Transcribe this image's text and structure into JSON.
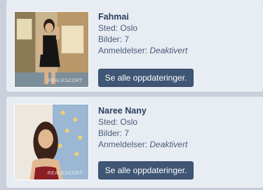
{
  "listings": [
    {
      "name": "Fahmai",
      "location_label": "Sted: ",
      "location": "Oslo",
      "photos_label": "Bilder: ",
      "photos": "7",
      "reviews_label": "Anmeldelser: ",
      "reviews": "Deaktivert",
      "button": "Se alle oppdateringer.",
      "watermark": "REALESCORT"
    },
    {
      "name": "Naree Nany",
      "location_label": "Sted: ",
      "location": "Oslo",
      "photos_label": "Bilder: ",
      "photos": "7",
      "reviews_label": "Anmeldelser: ",
      "reviews": "Deaktivert",
      "button": "Se alle oppdateringer.",
      "watermark": "REALESCORT"
    }
  ],
  "colors": {
    "page_bg": "#c9d0dc",
    "card_bg": "#e8ecf3",
    "button_bg": "#3f5675",
    "name_text": "#2b3f5e"
  }
}
